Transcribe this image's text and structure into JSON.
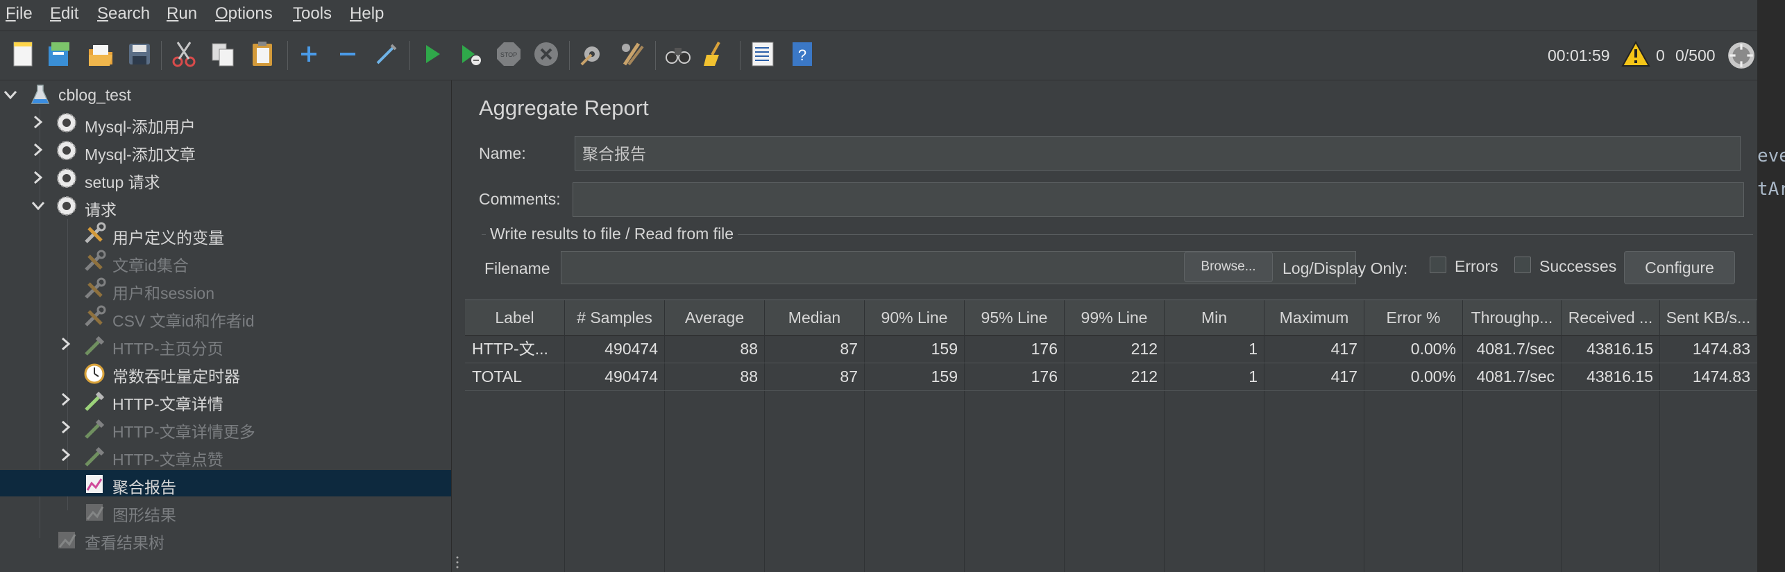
{
  "menu": [
    "File",
    "Edit",
    "Search",
    "Run",
    "Options",
    "Tools",
    "Help"
  ],
  "status": {
    "elapsed": "00:01:59",
    "errors": "0",
    "threads": "0/500"
  },
  "tree": [
    {
      "label": "cblog_test",
      "indent": 0,
      "expander": "down",
      "icon": "flask",
      "disabled": false
    },
    {
      "label": "Mysql-添加用户",
      "indent": 1,
      "expander": "right",
      "icon": "gear",
      "disabled": false
    },
    {
      "label": "Mysql-添加文章",
      "indent": 1,
      "expander": "right",
      "icon": "gear",
      "disabled": false
    },
    {
      "label": "setup 请求",
      "indent": 1,
      "expander": "right",
      "icon": "gear",
      "disabled": false
    },
    {
      "label": "请求",
      "indent": 1,
      "expander": "down",
      "icon": "gear",
      "disabled": false
    },
    {
      "label": "用户定义的变量",
      "indent": 2,
      "expander": "",
      "icon": "wrench",
      "disabled": false
    },
    {
      "label": "文章id集合",
      "indent": 2,
      "expander": "",
      "icon": "wrench",
      "disabled": true
    },
    {
      "label": "用户和session",
      "indent": 2,
      "expander": "",
      "icon": "wrench",
      "disabled": true
    },
    {
      "label": "CSV 文章id和作者id",
      "indent": 2,
      "expander": "",
      "icon": "wrench",
      "disabled": true
    },
    {
      "label": "HTTP-主页分页",
      "indent": 2,
      "expander": "right",
      "icon": "pipette",
      "disabled": true
    },
    {
      "label": "常数吞吐量定时器",
      "indent": 2,
      "expander": "",
      "icon": "timer",
      "disabled": false
    },
    {
      "label": "HTTP-文章详情",
      "indent": 2,
      "expander": "right",
      "icon": "pipette",
      "disabled": false
    },
    {
      "label": "HTTP-文章详情更多",
      "indent": 2,
      "expander": "right",
      "icon": "pipette",
      "disabled": true
    },
    {
      "label": "HTTP-文章点赞",
      "indent": 2,
      "expander": "right",
      "icon": "pipette",
      "disabled": true
    },
    {
      "label": "聚合报告",
      "indent": 2,
      "expander": "",
      "icon": "report",
      "disabled": false,
      "selected": true
    },
    {
      "label": "图形结果",
      "indent": 2,
      "expander": "",
      "icon": "graph",
      "disabled": true
    },
    {
      "label": "查看结果树",
      "indent": 1,
      "expander": "",
      "icon": "graph",
      "disabled": true
    }
  ],
  "panel": {
    "title": "Aggregate Report",
    "name_label": "Name:",
    "name_value": "聚合报告",
    "comments_label": "Comments:",
    "comments_value": "",
    "fieldset_title": "Write results to file / Read from file",
    "filename_label": "Filename",
    "filename_value": "",
    "browse_label": "Browse...",
    "log_display_label": "Log/Display Only:",
    "errors_label": "Errors",
    "successes_label": "Successes",
    "configure_label": "Configure"
  },
  "table": {
    "columns": [
      "Label",
      "# Samples",
      "Average",
      "Median",
      "90% Line",
      "95% Line",
      "99% Line",
      "Min",
      "Maximum",
      "Error %",
      "Throughp...",
      "Received ...",
      "Sent KB/s..."
    ],
    "rows": [
      [
        "HTTP-文...",
        "490474",
        "88",
        "87",
        "159",
        "176",
        "212",
        "1",
        "417",
        "0.00%",
        "4081.7/sec",
        "43816.15",
        "1474.83"
      ],
      [
        "TOTAL",
        "490474",
        "88",
        "87",
        "159",
        "176",
        "212",
        "1",
        "417",
        "0.00%",
        "4081.7/sec",
        "43816.15",
        "1474.83"
      ]
    ]
  },
  "background_editor": [
    "eve",
    "tAr"
  ]
}
